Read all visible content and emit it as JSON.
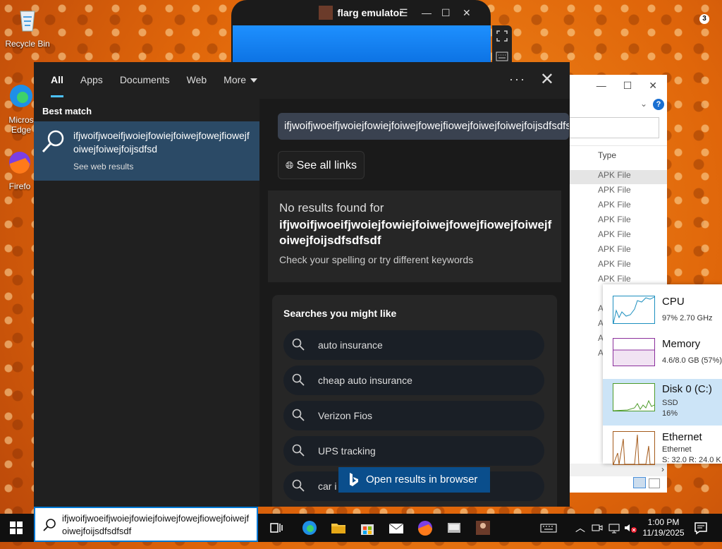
{
  "desktop": {
    "recycle_bin": "Recycle Bin",
    "edge_label_1": "Micros",
    "edge_label_2": "Edge",
    "firefox_label": "Firefo"
  },
  "emulator": {
    "title": "flarg emulator"
  },
  "explorer": {
    "col_type": "Type",
    "rows": [
      "APK File",
      "APK File",
      "APK File",
      "APK File",
      "APK File",
      "APK File",
      "APK File",
      "APK File"
    ],
    "partial_rows": [
      "A",
      "A",
      "A",
      "A"
    ]
  },
  "taskmgr": {
    "cpu": {
      "name": "CPU",
      "detail": "97%  2.70 GHz"
    },
    "memory": {
      "name": "Memory",
      "detail": "4.6/8.0 GB (57%)"
    },
    "disk": {
      "name": "Disk 0 (C:)",
      "type": "SSD",
      "detail": "16%"
    },
    "ethernet": {
      "name": "Ethernet",
      "type": "Ethernet",
      "detail": "S: 32.0  R: 24.0 K"
    }
  },
  "search": {
    "tabs": [
      "All",
      "Apps",
      "Documents",
      "Web",
      "More"
    ],
    "best_match_label": "Best match",
    "best_match_title": "ifjwoifjwoeifjwoiejfowiejfoiwejfowejfiowejfoiwejfoiwejfoijsdfsd",
    "best_match_sub": "See web results",
    "query_box": "ifjwoifjwoeifjwoiejfowiejfoiwejfowejfiowejfoiwejfoiwejfoijsdfsdfsdf",
    "see_all_links": "See all links",
    "no_results_title": "No results found for",
    "no_results_query": "ifjwoifjwoeifjwoiejfowiejfoiwejfowejfiowejfoiwejfoiwejfoijsdfsdfsdf",
    "no_results_hint": "Check your spelling or try different keywords",
    "suggest_heading": "Searches you might like",
    "suggestions": [
      "auto insurance",
      "cheap auto insurance",
      "Verizon Fios",
      "UPS tracking",
      "car i"
    ],
    "open_in_browser": "Open results in browser"
  },
  "taskbar": {
    "search_text": "ifjwoifjwoeifjwoiejfowiejfoiwejfowejfiowejfoiwejfoiwejfoijsdfsdfsdf",
    "time": "1:00 PM",
    "date": "11/19/2025",
    "notifications": "3"
  },
  "colors": {
    "accent": "#4cc2ff",
    "best_match_bg": "#2b4a66",
    "open_browser_bg": "#0a4e8c"
  }
}
